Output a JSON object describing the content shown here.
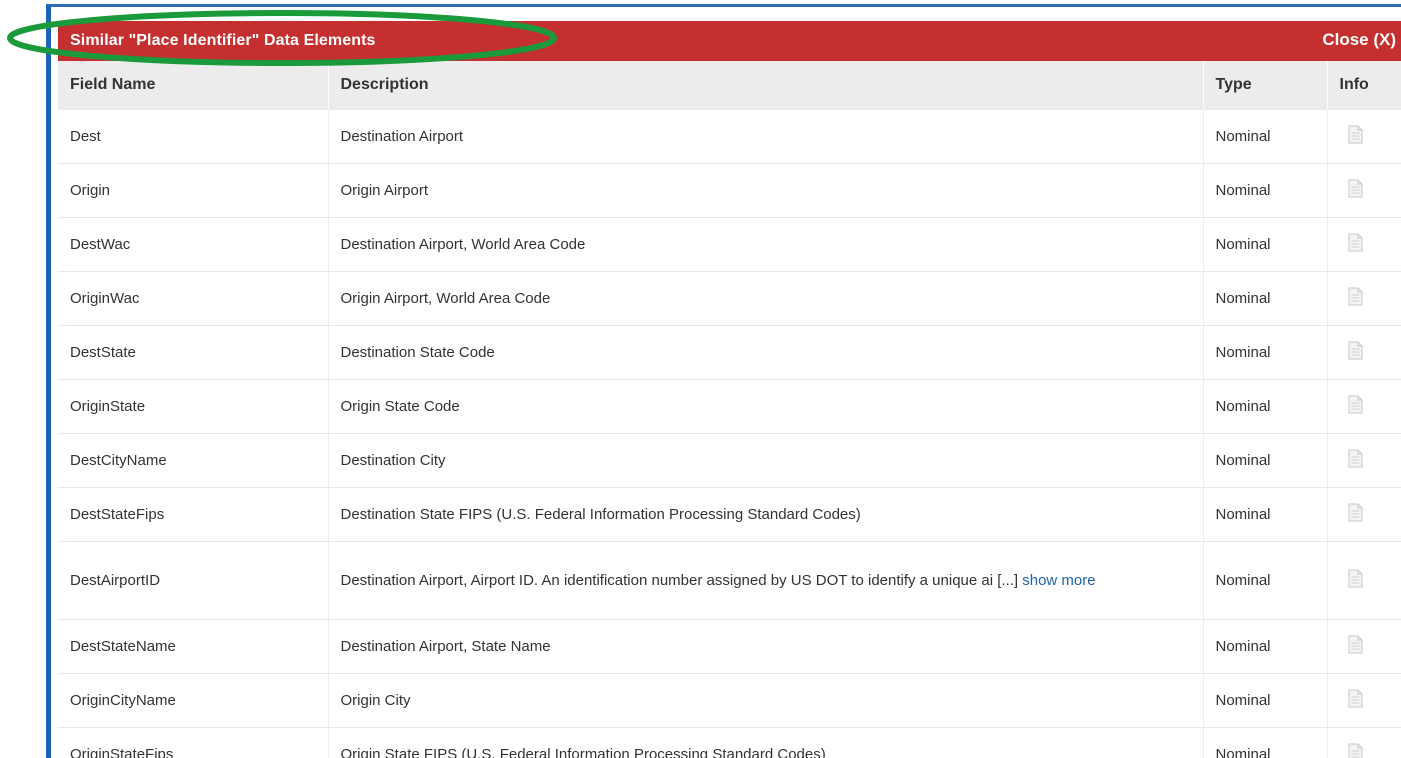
{
  "dialog": {
    "title": "Similar \"Place Identifier\" Data Elements",
    "close_label": "Close (X)"
  },
  "table": {
    "columns": [
      "Field Name",
      "Description",
      "Type",
      "Info"
    ],
    "rows": [
      {
        "field": "Dest",
        "description": "Destination Airport",
        "type": "Nominal"
      },
      {
        "field": "Origin",
        "description": "Origin Airport",
        "type": "Nominal"
      },
      {
        "field": "DestWac",
        "description": "Destination Airport, World Area Code",
        "type": "Nominal"
      },
      {
        "field": "OriginWac",
        "description": "Origin Airport, World Area Code",
        "type": "Nominal"
      },
      {
        "field": "DestState",
        "description": "Destination State Code",
        "type": "Nominal"
      },
      {
        "field": "OriginState",
        "description": "Origin State Code",
        "type": "Nominal"
      },
      {
        "field": "DestCityName",
        "description": "Destination City",
        "type": "Nominal"
      },
      {
        "field": "DestStateFips",
        "description": "Destination State FIPS (U.S. Federal Information Processing Standard Codes)",
        "type": "Nominal"
      },
      {
        "field": "DestAirportID",
        "description": "Destination Airport, Airport ID. An identification number assigned by US DOT to identify a unique ai [...]",
        "show_more": "show more",
        "type": "Nominal"
      },
      {
        "field": "DestStateName",
        "description": "Destination Airport, State Name",
        "type": "Nominal"
      },
      {
        "field": "OriginCityName",
        "description": "Origin City",
        "type": "Nominal"
      },
      {
        "field": "OriginStateFips",
        "description": "Origin State FIPS (U.S. Federal Information Processing Standard Codes)",
        "type": "Nominal"
      }
    ]
  },
  "icons": {
    "info": "document-icon"
  },
  "colors": {
    "title_bar": "#c62f2f",
    "frame_border": "#1c64b8",
    "highlight_ellipse": "#1a9a3a",
    "link": "#1f63a8"
  }
}
